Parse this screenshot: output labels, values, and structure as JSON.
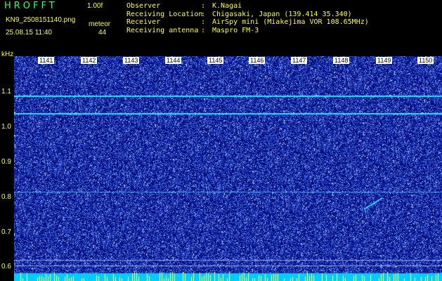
{
  "header": {
    "title": "HROFFT",
    "version": "1.00f",
    "filename": "KN9_2508151140.png",
    "mode": "meteor",
    "count": "44",
    "timestamp": "25.08.15 11:40"
  },
  "meta": [
    {
      "label": "Observer",
      "sep": ":",
      "value": "K.Nagai"
    },
    {
      "label": "Receiving Location",
      "sep": ":",
      "value": "Chigasaki, Japan (139.414 35.340)"
    },
    {
      "label": "Receiver",
      "sep": ":",
      "value": "AirSpy mini (Miakejima VOR 108.65MHz)"
    },
    {
      "label": "Receiving antenna",
      "sep": ":",
      "value": "Maspro FM-3"
    }
  ],
  "axis": {
    "unit": "kHz",
    "y_labels": [
      "1.1",
      "1.0",
      "0.9",
      "0.8",
      "0.7",
      "0.6"
    ],
    "x_labels": [
      "1141",
      "1142",
      "1143",
      "1144",
      "1145",
      "1146",
      "1147",
      "1148",
      "1149",
      "1150"
    ]
  },
  "colors": {
    "background": "#000a78",
    "noise": "#4c6cff",
    "signal": "#30e0ff",
    "header_yellow": "#ffff33",
    "title_green": "#33ff66"
  }
}
